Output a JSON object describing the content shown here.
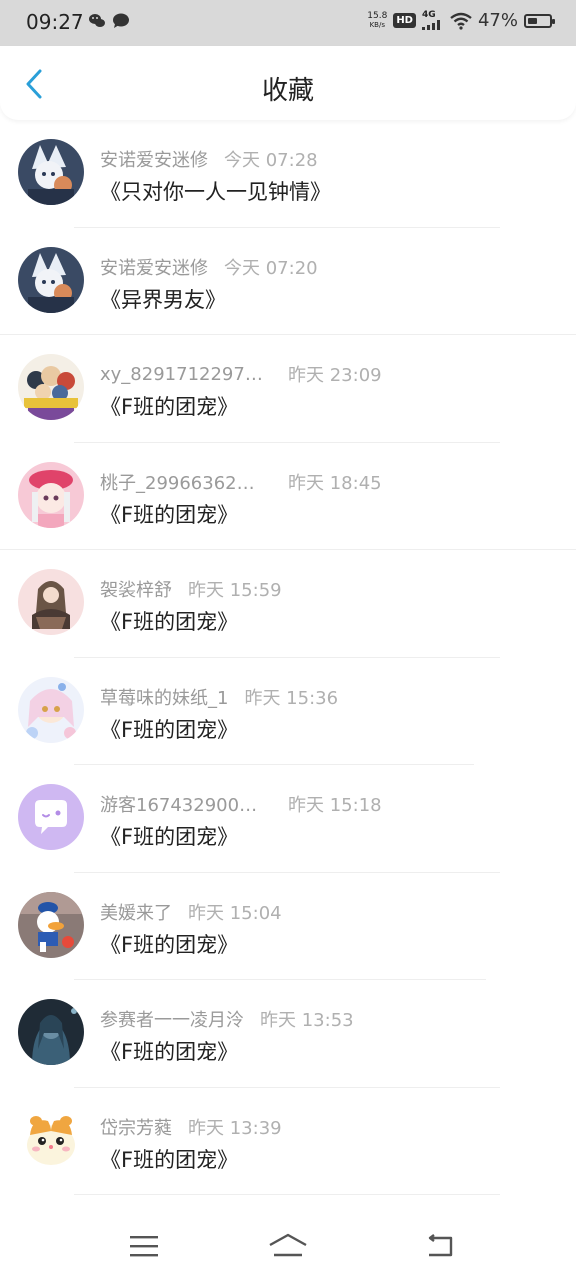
{
  "status_bar": {
    "time": "09:27",
    "speed_value": "15.8",
    "speed_unit": "KB/s",
    "hd": "HD",
    "network": "4G",
    "battery": "47%",
    "battery_level": 0.47
  },
  "header": {
    "title": "收藏"
  },
  "items": [
    {
      "name": "安诺爱安迷修",
      "time": "今天 07:28",
      "title": "《只对你一人一见钟情》"
    },
    {
      "name": "安诺爱安迷修",
      "time": "今天 07:20",
      "title": "《异界男友》"
    },
    {
      "name": "xy_82917122971…",
      "time": "昨天 23:09",
      "title": "《F班的团宠》"
    },
    {
      "name": "桃子_29966362…",
      "time": "昨天 18:45",
      "title": "《F班的团宠》"
    },
    {
      "name": "袈裟梓舒",
      "time": "昨天 15:59",
      "title": "《F班的团宠》"
    },
    {
      "name": "草莓味的妹纸_1",
      "time": "昨天 15:36",
      "title": "《F班的团宠》"
    },
    {
      "name": "游客167432900…",
      "time": "昨天 15:18",
      "title": "《F班的团宠》"
    },
    {
      "name": "美媛来了",
      "time": "昨天 15:04",
      "title": "《F班的团宠》"
    },
    {
      "name": "参赛者一一凌月泠",
      "time": "昨天 13:53",
      "title": "《F班的团宠》"
    },
    {
      "name": "岱宗芳蕤",
      "time": "昨天 13:39",
      "title": "《F班的团宠》"
    }
  ],
  "colors": {
    "accent": "#2a9fd8",
    "status_bar_bg": "#d9d9d9",
    "meta_text": "#9a9a9a",
    "title_text": "#222222"
  }
}
